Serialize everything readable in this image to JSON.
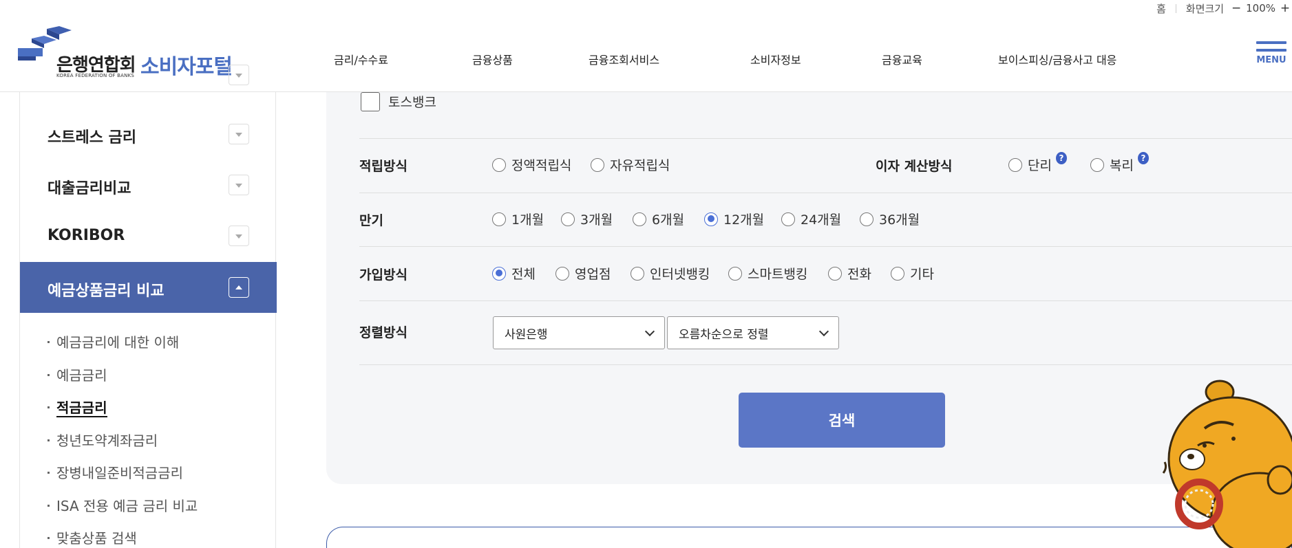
{
  "utility": {
    "home": "홈",
    "zoom_label": "화면크기",
    "zoom_minus": "−",
    "zoom_value": "100%",
    "zoom_plus": "+"
  },
  "logo": {
    "org_name": "은행연합회",
    "org_name_en": "KOREA FEDERATION OF BANKS",
    "portal_name": "소비자포털"
  },
  "gnb": [
    {
      "label": "금리/수수료"
    },
    {
      "label": "금융상품"
    },
    {
      "label": "금융조회서비스"
    },
    {
      "label": "소비자정보"
    },
    {
      "label": "금융교육"
    },
    {
      "label": "보이스피싱/금융사고 대응"
    }
  ],
  "menu_label": "MENU",
  "sidebar": {
    "items": [
      {
        "label": "스트레스 금리"
      },
      {
        "label": "대출금리비교"
      },
      {
        "label": "KORIBOR"
      },
      {
        "label": "예금상품금리 비교"
      }
    ],
    "sub_items": [
      {
        "label": "예금금리에 대한 이해"
      },
      {
        "label": "예금금리"
      },
      {
        "label": "적금금리"
      },
      {
        "label": "청년도약계좌금리"
      },
      {
        "label": "장병내일준비적금금리"
      },
      {
        "label": "ISA 전용 예금 금리 비교"
      },
      {
        "label": "맞춤상품 검색"
      }
    ]
  },
  "form": {
    "bank_checkbox_label": "토스뱅크",
    "saving_method": {
      "label": "적립방식",
      "options": [
        "정액적립식",
        "자유적립식"
      ]
    },
    "interest_method": {
      "label": "이자 계산방식",
      "options": [
        "단리",
        "복리"
      ],
      "help": "?"
    },
    "term": {
      "label": "만기",
      "options": [
        "1개월",
        "3개월",
        "6개월",
        "12개월",
        "24개월",
        "36개월"
      ],
      "selected": "12개월"
    },
    "join_method": {
      "label": "가입방식",
      "options": [
        "전체",
        "영업점",
        "인터넷뱅킹",
        "스마트뱅킹",
        "전화",
        "기타"
      ],
      "selected": "전체"
    },
    "sort": {
      "label": "정렬방식",
      "field_value": "사원은행",
      "order_value": "오름차순으로 정렬"
    },
    "search_label": "검색"
  },
  "colors": {
    "brand": "#4a6fc2",
    "sidebar_active": "#4a64a9",
    "search_button": "#5b76c6",
    "panel_bg": "#f5f6f8"
  }
}
